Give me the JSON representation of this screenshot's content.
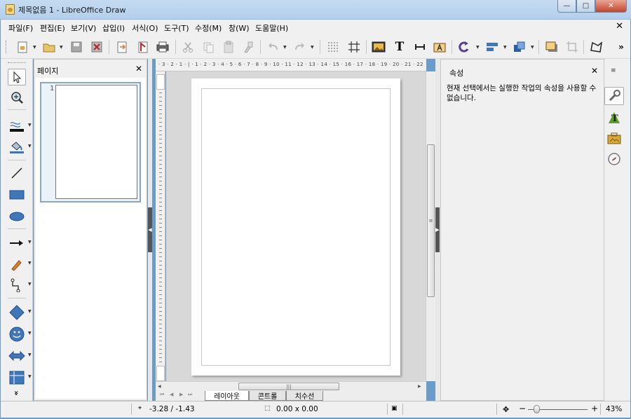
{
  "window": {
    "title": "제목없음 1 - LibreOffice Draw",
    "minimize_label": "—",
    "maximize_label": "□",
    "close_label": "✕"
  },
  "menubar": {
    "items": [
      "파일(F)",
      "편집(E)",
      "보기(V)",
      "삽입(I)",
      "서식(O)",
      "도구(T)",
      "수정(M)",
      "창(W)",
      "도움말(H)"
    ],
    "close_doc_label": "✕"
  },
  "toolbar": {
    "icons": [
      "new-document-icon",
      "open-icon",
      "save-icon",
      "export-pdf-icon",
      "import-icon",
      "export-directly-pdf-icon",
      "print-icon",
      "cut-icon",
      "copy-icon",
      "paste-icon",
      "clone-formatting-icon",
      "undo-icon",
      "redo-icon",
      "grid-icon",
      "helplines-icon",
      "image-icon",
      "text-icon",
      "dimension-line-icon",
      "fontwork-icon",
      "rotate-icon",
      "align-icon",
      "arrange-icon",
      "shadow-icon",
      "crop-icon",
      "points-icon"
    ],
    "text_tool_glyph": "T",
    "overflow_label": "»"
  },
  "left_tools": {
    "icons": [
      "select-icon",
      "zoom-icon",
      "line-color-icon",
      "fill-color-icon",
      "line-icon",
      "rectangle-icon",
      "ellipse-icon",
      "arrow-line-icon",
      "curve-icon",
      "connector-icon",
      "basic-shapes-icon",
      "symbol-shapes-icon",
      "block-arrows-icon",
      "flowchart-icon"
    ],
    "more_label": "»"
  },
  "pages_panel": {
    "title": "페이지",
    "close_label": "✕",
    "thumbnails": [
      {
        "number": "1"
      }
    ]
  },
  "ruler": {
    "horizontal_text": "· 3 · 2 · 1 · | · 1 · 2 · 3 · 4 · 5 · 6 · 7 · 8 · 9 · 10 · 11 · 12 · 13 · 14 · 15 · 16 · 17 · 18 · 19 · 20 · 21 · 22"
  },
  "tabs": {
    "nav": [
      "⏮",
      "◀",
      "▶",
      "⏭"
    ],
    "items": [
      {
        "label": "레이아웃",
        "active": true
      },
      {
        "label": "콘트롤",
        "active": false
      },
      {
        "label": "치수선",
        "active": false
      }
    ]
  },
  "sidebar": {
    "title": "속성",
    "close_label": "✕",
    "message": "현재 선택에서는 실행한 작업의 속성을 사용할 수 없습니다.",
    "menu_label": "≡",
    "deck_icons": [
      "properties-wrench-icon",
      "styles-formatting-icon",
      "gallery-icon",
      "navigator-icon"
    ]
  },
  "statusbar": {
    "position": "-3.28 / -1.43",
    "size": "0.00 x 0.00",
    "zoom_minus": "−",
    "zoom_plus": "+",
    "zoom": "43%",
    "zoom_level_fraction": 0.15
  },
  "colors": {
    "titlebar": "#c5dbf1",
    "chrome": "#f0f0f0",
    "canvas_bg": "#d8d8d8",
    "page": "#ffffff",
    "close_red": "#c4442b"
  }
}
